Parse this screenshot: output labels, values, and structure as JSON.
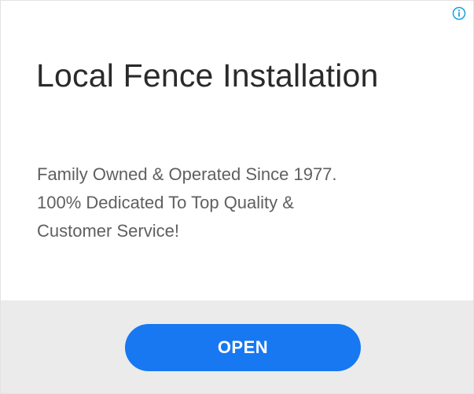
{
  "ad": {
    "headline": "Local Fence Installation",
    "body_lines": [
      "Family Owned & Operated Since 1977.",
      "100% Dedicated To Top Quality &",
      "Customer Service!"
    ],
    "cta_label": "OPEN",
    "info_icon": "info-icon"
  },
  "colors": {
    "accent": "#1778f2",
    "info_icon": "#1a9fe0",
    "footer_background": "#ebebeb",
    "headline": "#2a2a2a",
    "body_text": "#5f5f5f"
  }
}
